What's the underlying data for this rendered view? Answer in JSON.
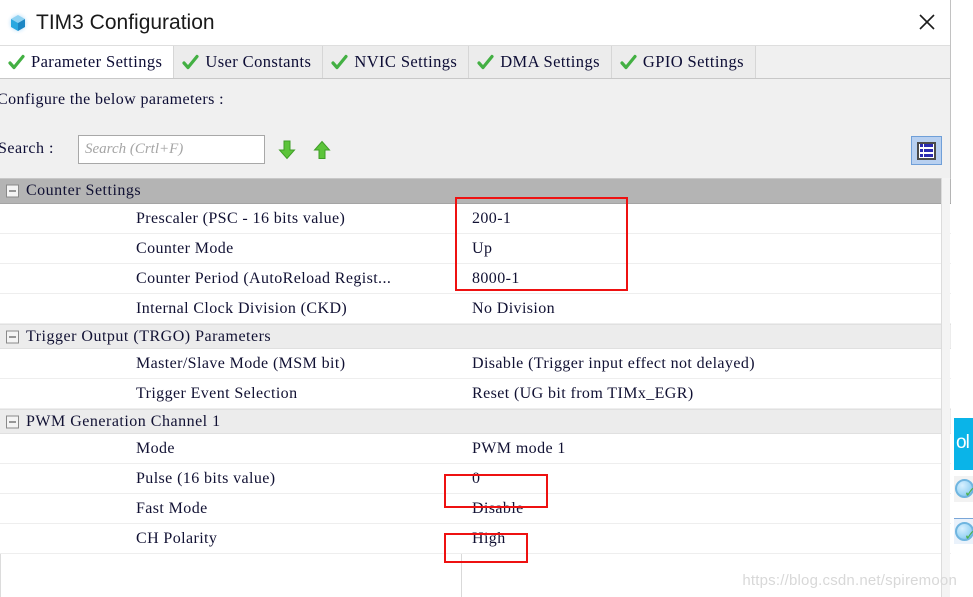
{
  "window": {
    "title": "TIM3 Configuration",
    "icon": "cube-icon",
    "close_label": "✕"
  },
  "tabs": [
    {
      "label": "Parameter Settings",
      "icon": "green-check-icon",
      "active": true
    },
    {
      "label": "User Constants",
      "icon": "green-check-icon",
      "active": false
    },
    {
      "label": "NVIC Settings",
      "icon": "green-check-icon",
      "active": false
    },
    {
      "label": "DMA Settings",
      "icon": "green-check-icon",
      "active": false
    },
    {
      "label": "GPIO Settings",
      "icon": "green-check-icon",
      "active": false
    }
  ],
  "configure_text": "Configure the below parameters :",
  "search": {
    "label": "Search :",
    "value": "",
    "placeholder": "Search (Crtl+F)",
    "down_icon": "arrow-down-icon",
    "up_icon": "arrow-up-icon"
  },
  "toolbar": {
    "list_toggle_icon": "list-view-icon"
  },
  "table": {
    "groups": [
      {
        "label": "Counter Settings",
        "style": "dark",
        "rows": [
          {
            "label": "Prescaler (PSC - 16 bits value)",
            "value": "200-1"
          },
          {
            "label": "Counter Mode",
            "value": "Up"
          },
          {
            "label": "Counter Period (AutoReload Regist...",
            "value": "8000-1"
          },
          {
            "label": "Internal Clock Division (CKD)",
            "value": "No Division"
          }
        ]
      },
      {
        "label": "Trigger Output (TRGO) Parameters",
        "style": "light",
        "rows": [
          {
            "label": "Master/Slave Mode (MSM bit)",
            "value": "Disable (Trigger input effect not delayed)"
          },
          {
            "label": "Trigger Event Selection",
            "value": "Reset (UG bit from TIMx_EGR)"
          }
        ]
      },
      {
        "label": "PWM Generation Channel 1",
        "style": "light",
        "rows": [
          {
            "label": "Mode",
            "value": "PWM mode 1"
          },
          {
            "label": "Pulse (16 bits value)",
            "value": "0"
          },
          {
            "label": "Fast Mode",
            "value": "Disable"
          },
          {
            "label": "CH Polarity",
            "value": "High"
          }
        ]
      }
    ]
  },
  "annotations": {
    "highlight_color": "#ee1111",
    "boxes": [
      "counter-values",
      "pulse-value",
      "ch-polarity-value"
    ]
  },
  "watermark": "https://blog.csdn.net/spiremoon",
  "background_window": {
    "banner_text": "ol"
  }
}
